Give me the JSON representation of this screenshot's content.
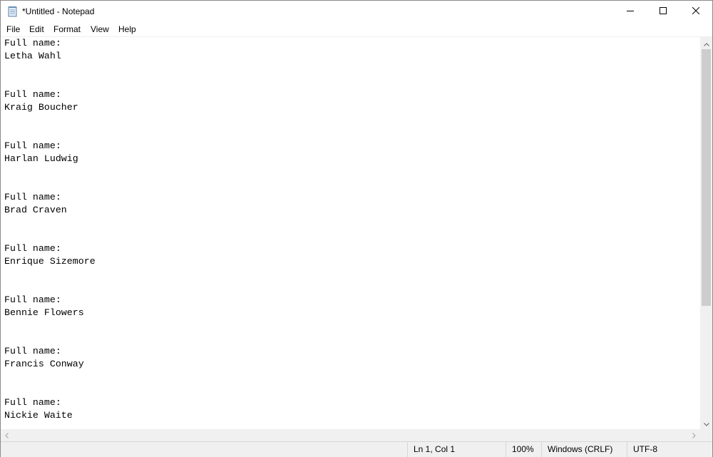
{
  "window": {
    "title": "*Untitled - Notepad",
    "icon": "notepad-icon",
    "controls": {
      "minimize_icon": "minimize-icon",
      "maximize_icon": "maximize-icon",
      "close_icon": "close-icon"
    }
  },
  "menu": {
    "file": "File",
    "edit": "Edit",
    "format": "Format",
    "view": "View",
    "help": "Help"
  },
  "editor": {
    "content": "Full name:\nLetha Wahl\n\n\nFull name:\nKraig Boucher\n\n\nFull name:\nHarlan Ludwig\n\n\nFull name:\nBrad Craven\n\n\nFull name:\nEnrique Sizemore\n\n\nFull name:\nBennie Flowers\n\n\nFull name:\nFrancis Conway\n\n\nFull name:\nNickie Waite"
  },
  "status": {
    "position": "Ln 1, Col 1",
    "zoom": "100%",
    "line_ending": "Windows (CRLF)",
    "encoding": "UTF-8"
  },
  "colors": {
    "background": "#ffffff",
    "chrome": "#f0f0f0",
    "scroll_thumb": "#cdcdcd"
  }
}
